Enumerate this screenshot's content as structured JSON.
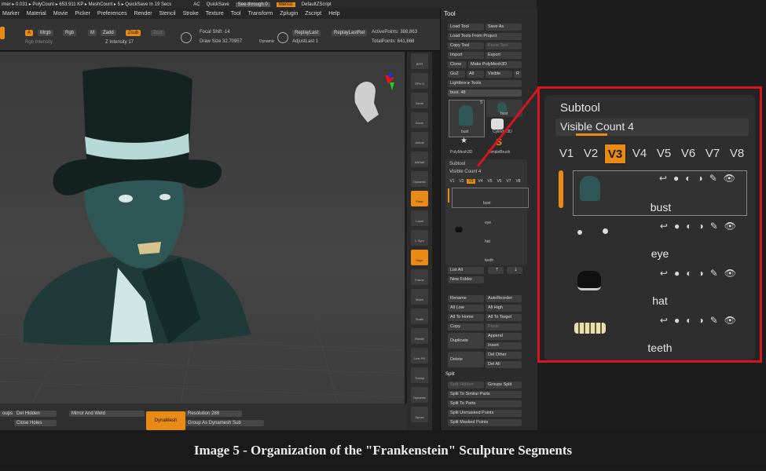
{
  "topbar": {
    "left_text": "imer ▸ 0.031 ▸ PolyCount ▸ 653.911 KP ▸ MeshCount ▸ 5 ▸ QuickSave In 19 Secs",
    "ac": "AC",
    "quicksave": "QuickSave",
    "seethrough": "See-through  0",
    "menus": "Menus",
    "default_script": "DefaultZScript"
  },
  "menubar": [
    "Marker",
    "Material",
    "Movie",
    "Picker",
    "Preferences",
    "Render",
    "Stencil",
    "Stroke",
    "Texture",
    "Tool",
    "Transform",
    "Zplugin",
    "Zscript",
    "Help"
  ],
  "toolbar": {
    "a": "A",
    "mrgb": "Mrgb",
    "rgb": "Rgb",
    "m": "M",
    "zadd": "Zadd",
    "zsub": "Zsub",
    "zcut": "Zcut",
    "rgb_intensity": "Rgb Intensity",
    "z_intensity": "Z Intensity 17",
    "focal_shift": "Focal Shift -14",
    "draw_size": "Draw Size 32.70957",
    "dynamic": "Dynamic",
    "replay_last": "ReplayLast",
    "replay_last_rel": "ReplayLastRel",
    "adjust_last": "AdjustLast 1",
    "active_points": "ActivePoints: 388,863",
    "total_points": "TotalPoints: 641,668"
  },
  "shelf": [
    "BPR",
    "SPix 3",
    "Scroll",
    "Zoom",
    "Actual",
    "AAHalf",
    "Dynamic Persp",
    "Floor",
    "Local",
    "L.Sym",
    "Gxyz",
    "Frame",
    "Move",
    "Scale",
    "Rotate",
    "Line Fill PolyF",
    "Transp",
    "Dynamic Solo",
    "Xpose"
  ],
  "bottombar": {
    "groups": "oups",
    "del_hidden": "Del Hidden",
    "close_holes": "Close Holes",
    "mirror_weld": "Mirror And Weld",
    "dynamesh": "DynaMesh",
    "resolution": "Resolution 288",
    "group_as": "Group As Dynamesh Sub"
  },
  "toolpanel": {
    "title": "Tool",
    "buttons": [
      "Load Tool",
      "Save As",
      "Load Tools From Project",
      "Copy Tool",
      "Paste Tool",
      "Import",
      "Export",
      "Clone",
      "Make PolyMesh3D",
      "GoZ",
      "All",
      "Visible",
      "R",
      "Lightbox ▸ Tools"
    ],
    "bust_slider": "bust. 48",
    "thumbs": [
      "bust",
      "Cylinder3D",
      "PolyMesh3D",
      "SimpleBrush"
    ],
    "thumb_count": "5",
    "subtool_header": "Subtool",
    "visible_count": "Visible Count 4",
    "vtabs": [
      "V1",
      "V2",
      "V3",
      "V4",
      "V5",
      "V6",
      "V7",
      "V8"
    ],
    "subtools": [
      "bust",
      "eye",
      "hat",
      "teeth"
    ],
    "list_all": "List All",
    "new_folder": "New Folder",
    "ops": [
      "Rename",
      "AutoReorder",
      "All Low",
      "All High",
      "All To Home",
      "All To Target",
      "Copy",
      "Paste",
      "Duplicate",
      "Append",
      "Insert",
      "Delete",
      "Del Other",
      "Del All"
    ],
    "split_header": "Split",
    "split_ops": [
      "Split Hidden",
      "Groups Split",
      "Split To Similar Parts",
      "Split To Parts",
      "Split Unmasked Points",
      "Split Masked Points"
    ]
  },
  "zoom": {
    "subtool_header": "Subtool",
    "visible_count": "Visible Count 4",
    "vtabs": [
      "V1",
      "V2",
      "V3",
      "V4",
      "V5",
      "V6",
      "V7",
      "V8"
    ],
    "active_tab": "V3",
    "subtools": [
      "bust",
      "eye",
      "hat",
      "teeth"
    ]
  },
  "caption": "Image 5 - Organization of the \"Frankenstein\" Sculpture Segments",
  "colors": {
    "accent": "#e98a17",
    "highlight": "#d8141c",
    "background": "#1d1d1d"
  }
}
